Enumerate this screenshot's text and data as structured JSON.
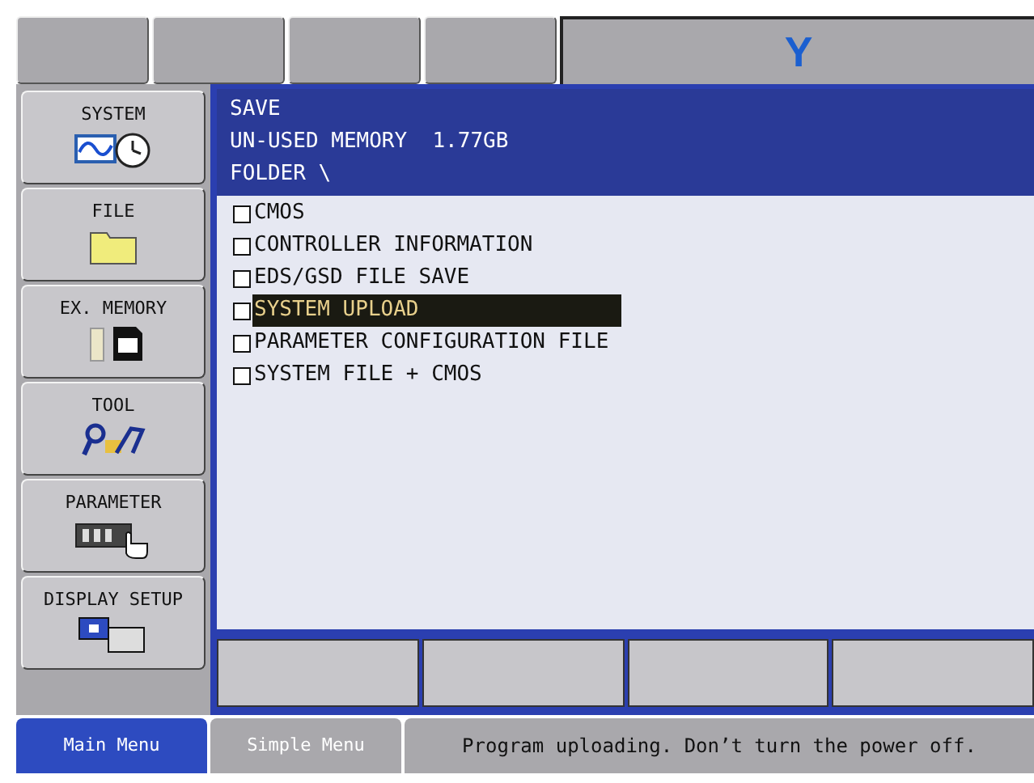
{
  "top_bar": {
    "axis_label": "Y"
  },
  "side_menu": [
    {
      "label": "SYSTEM",
      "kind": "system"
    },
    {
      "label": "FILE",
      "kind": "file"
    },
    {
      "label": "EX. MEMORY",
      "kind": "memory"
    },
    {
      "label": "TOOL",
      "kind": "tool"
    },
    {
      "label": "PARAMETER",
      "kind": "parameter"
    },
    {
      "label": "DISPLAY SETUP",
      "kind": "display"
    }
  ],
  "content": {
    "header": [
      "SAVE",
      "UN-USED MEMORY  1.77GB",
      "FOLDER \\"
    ],
    "items": [
      {
        "label": "CMOS",
        "checked": false,
        "selected": false
      },
      {
        "label": "CONTROLLER INFORMATION",
        "checked": false,
        "selected": false
      },
      {
        "label": "EDS/GSD FILE SAVE",
        "checked": false,
        "selected": false
      },
      {
        "label": "SYSTEM UPLOAD",
        "checked": false,
        "selected": true
      },
      {
        "label": "PARAMETER CONFIGURATION FILE",
        "checked": false,
        "selected": false
      },
      {
        "label": "SYSTEM FILE + CMOS",
        "checked": false,
        "selected": false
      }
    ]
  },
  "bottom_tabs": [
    {
      "label": "Main Menu",
      "selected": true
    },
    {
      "label": "Simple Menu",
      "selected": false
    }
  ],
  "status_bar": "Program uploading. Don’t turn the power off."
}
